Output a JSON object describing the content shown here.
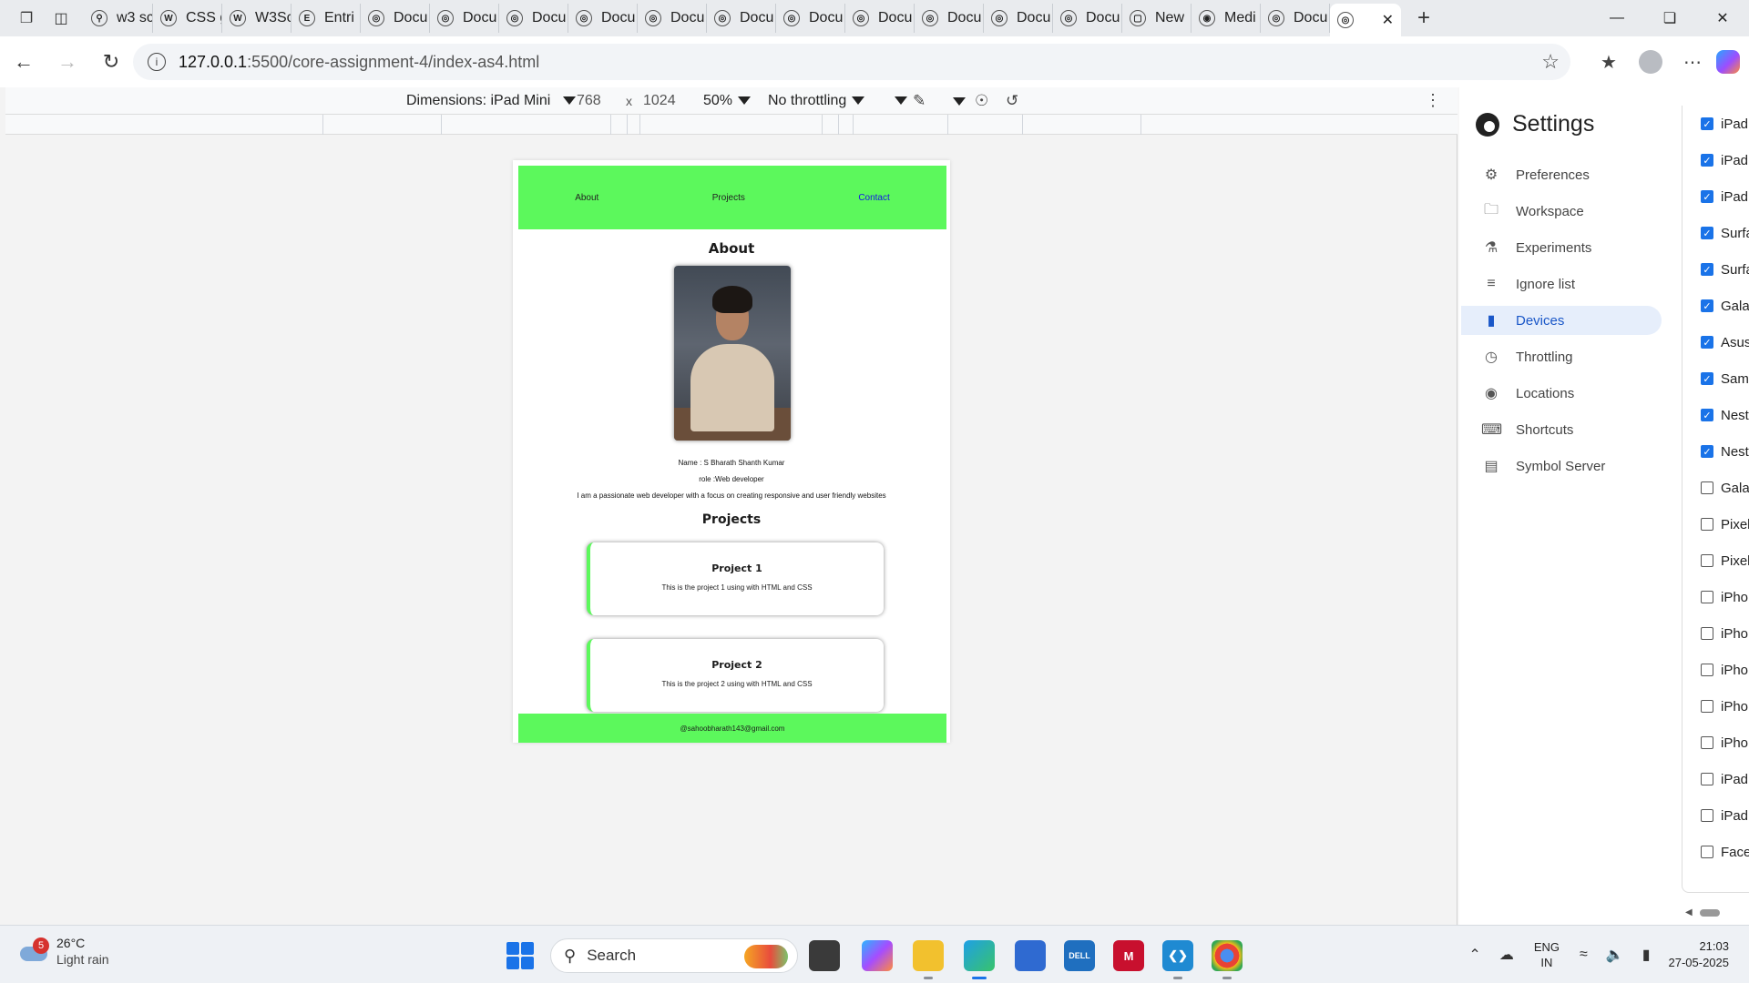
{
  "browser": {
    "tabs": [
      {
        "label": "w3 sc",
        "icon": "search-icon"
      },
      {
        "label": "CSS g",
        "icon": "w3-favicon"
      },
      {
        "label": "W3Sc",
        "icon": "w3-favicon"
      },
      {
        "label": "Entri",
        "icon": "entri-favicon"
      },
      {
        "label": "Docu",
        "icon": "globe-icon"
      },
      {
        "label": "Docu",
        "icon": "globe-icon"
      },
      {
        "label": "Docu",
        "icon": "globe-icon"
      },
      {
        "label": "Docu",
        "icon": "globe-icon"
      },
      {
        "label": "Docu",
        "icon": "globe-icon"
      },
      {
        "label": "Docu",
        "icon": "globe-icon"
      },
      {
        "label": "Docu",
        "icon": "globe-icon"
      },
      {
        "label": "Docu",
        "icon": "globe-icon"
      },
      {
        "label": "Docu",
        "icon": "globe-icon"
      },
      {
        "label": "Docu",
        "icon": "globe-icon"
      },
      {
        "label": "Docu",
        "icon": "globe-icon"
      },
      {
        "label": "New",
        "icon": "newtab-icon"
      },
      {
        "label": "Medi",
        "icon": "medium-favicon"
      },
      {
        "label": "Docu",
        "icon": "globe-icon"
      }
    ],
    "url_host": "127.0.0.1",
    "url_path": ":5500/core-assignment-4/index-as4.html"
  },
  "devtools": {
    "dimensions_label": "Dimensions: iPad Mini",
    "width": "768",
    "times": "x",
    "height": "1024",
    "zoom": "50%",
    "throttling": "No throttling"
  },
  "site": {
    "nav": [
      "About",
      "Projects",
      "Contact"
    ],
    "about_heading": "About",
    "name_line": "Name : S Bharath Shanth Kumar",
    "role_line": "role :Web developer",
    "bio": "I am a passionate web developer with a focus on creating responsive and user friendly websites",
    "projects_heading": "Projects",
    "projects": [
      {
        "title": "Project 1",
        "desc": "This is the project 1 using with HTML and CSS"
      },
      {
        "title": "Project 2",
        "desc": "This is the project 2 using with HTML and CSS"
      }
    ],
    "footer": "@sahoobharath143@gmail.com",
    "accent": "#5cf85c"
  },
  "settings": {
    "title": "Settings",
    "menu": [
      {
        "label": "Preferences",
        "icon": "gear-icon"
      },
      {
        "label": "Workspace",
        "icon": "folder-icon"
      },
      {
        "label": "Experiments",
        "icon": "flask-icon"
      },
      {
        "label": "Ignore list",
        "icon": "ignore-list-icon"
      },
      {
        "label": "Devices",
        "icon": "devices-icon"
      },
      {
        "label": "Throttling",
        "icon": "gauge-icon"
      },
      {
        "label": "Locations",
        "icon": "location-pin-icon"
      },
      {
        "label": "Shortcuts",
        "icon": "keyboard-icon"
      },
      {
        "label": "Symbol Server",
        "icon": "symbol-server-icon"
      }
    ],
    "active": "Devices",
    "devices": [
      {
        "label": "iPad",
        "checked": true
      },
      {
        "label": "iPad",
        "checked": true
      },
      {
        "label": "iPad",
        "checked": true
      },
      {
        "label": "Surfa",
        "checked": true
      },
      {
        "label": "Surfa",
        "checked": true
      },
      {
        "label": "Gala",
        "checked": true
      },
      {
        "label": "Asus",
        "checked": true
      },
      {
        "label": "Sam",
        "checked": true
      },
      {
        "label": "Nest",
        "checked": true
      },
      {
        "label": "Nest",
        "checked": true
      },
      {
        "label": "Gala",
        "checked": false
      },
      {
        "label": "Pixel",
        "checked": false
      },
      {
        "label": "Pixel",
        "checked": false
      },
      {
        "label": "iPho",
        "checked": false
      },
      {
        "label": "iPho",
        "checked": false
      },
      {
        "label": "iPho",
        "checked": false
      },
      {
        "label": "iPho",
        "checked": false
      },
      {
        "label": "iPho",
        "checked": false
      },
      {
        "label": "iPad",
        "checked": false
      },
      {
        "label": "iPad",
        "checked": false
      },
      {
        "label": "Face",
        "checked": false
      }
    ]
  },
  "taskbar": {
    "weather_badge": "5",
    "temperature": "26°C",
    "condition": "Light rain",
    "search_placeholder": "Search",
    "lang_top": "ENG",
    "lang_bottom": "IN",
    "time": "21:03",
    "date": "27-05-2025"
  }
}
